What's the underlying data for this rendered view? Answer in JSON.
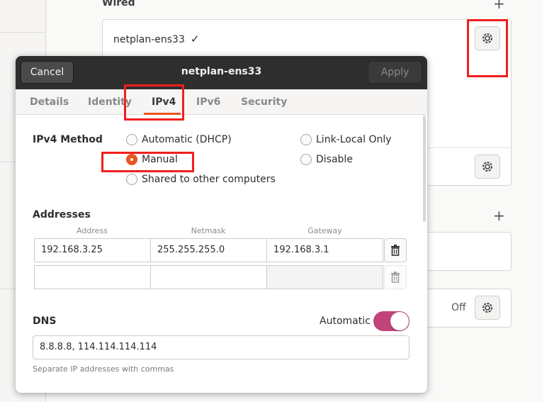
{
  "background": {
    "section_wired": "Wired",
    "connection_name": "netplan-ens33",
    "connection_check": "✓",
    "off_label": "Off"
  },
  "dialog": {
    "title": "netplan-ens33",
    "cancel_label": "Cancel",
    "apply_label": "Apply",
    "tabs": [
      "Details",
      "Identity",
      "IPv4",
      "IPv6",
      "Security"
    ],
    "active_tab": "IPv4",
    "ipv4_method_label": "IPv4 Method",
    "methods": {
      "automatic": "Automatic (DHCP)",
      "manual": "Manual",
      "shared": "Shared to other computers",
      "link_local": "Link-Local Only",
      "disable": "Disable"
    },
    "selected_method": "Manual",
    "addresses_label": "Addresses",
    "columns": [
      "Address",
      "Netmask",
      "Gateway"
    ],
    "rows": [
      {
        "address": "192.168.3.25",
        "netmask": "255.255.255.0",
        "gateway": "192.168.3.1"
      },
      {
        "address": "",
        "netmask": "",
        "gateway": ""
      }
    ],
    "dns_label": "DNS",
    "dns_automatic_label": "Automatic",
    "dns_automatic_on": true,
    "dns_value": "8.8.8.8, 114.114.114.114",
    "dns_hint": "Separate IP addresses with commas"
  },
  "colors": {
    "accent_orange": "#e95420",
    "switch_on": "#c2427a",
    "highlight_red": "#f21e1e",
    "titlebar": "#2e2e2e"
  },
  "icons": [
    "gear-icon",
    "trash-icon",
    "plus-icon",
    "check-icon"
  ]
}
